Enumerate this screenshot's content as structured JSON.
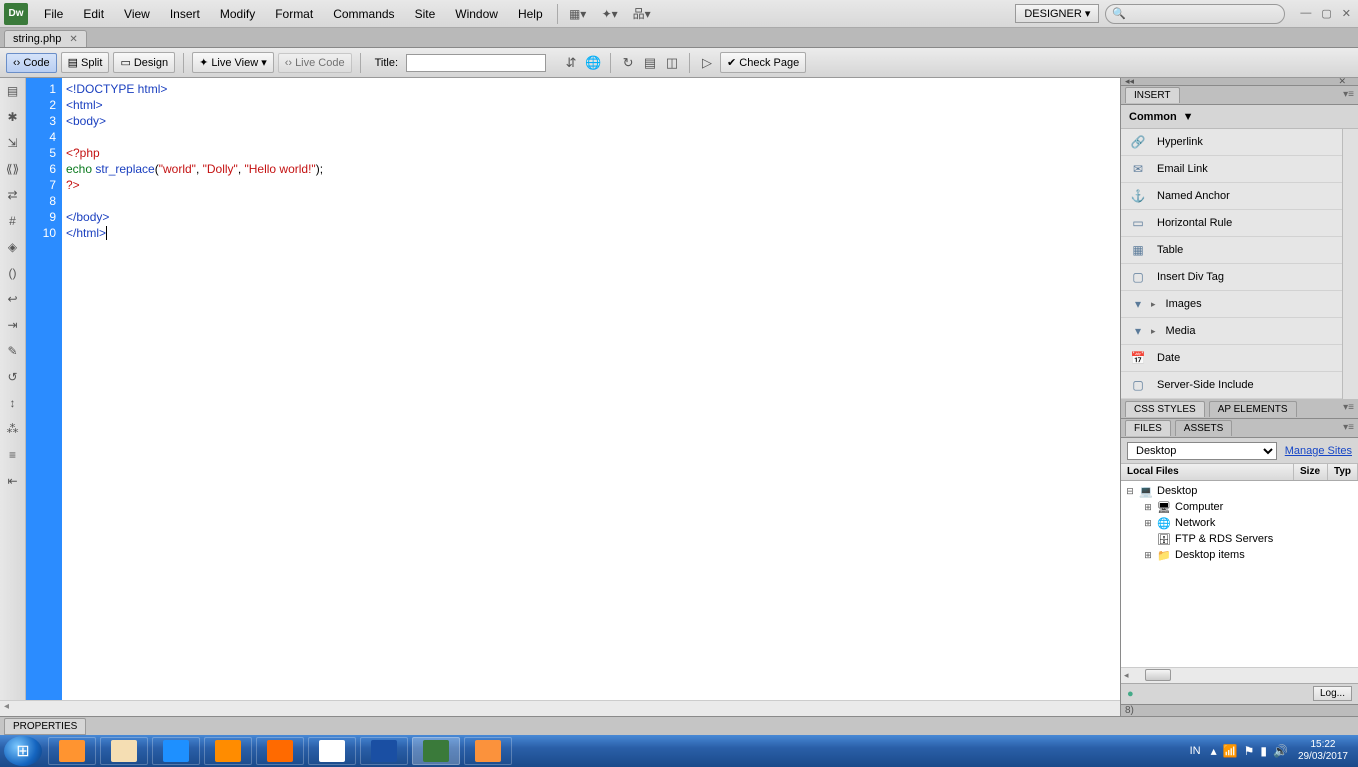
{
  "menubar": {
    "items": [
      "File",
      "Edit",
      "View",
      "Insert",
      "Modify",
      "Format",
      "Commands",
      "Site",
      "Window",
      "Help"
    ],
    "workspace_label": "DESIGNER ▾"
  },
  "tab": {
    "filename": "string.php"
  },
  "toolbar": {
    "code": "Code",
    "split": "Split",
    "design": "Design",
    "live_view": "Live View",
    "live_code": "Live Code",
    "title_label": "Title:",
    "title_value": "",
    "check_page": "Check Page"
  },
  "code": {
    "lines": [
      {
        "n": 1,
        "segs": [
          {
            "t": "<!DOCTYPE html>",
            "c": "c-blue"
          }
        ]
      },
      {
        "n": 2,
        "segs": [
          {
            "t": "<html>",
            "c": "c-blue"
          }
        ]
      },
      {
        "n": 3,
        "segs": [
          {
            "t": "<body>",
            "c": "c-blue"
          }
        ]
      },
      {
        "n": 4,
        "segs": []
      },
      {
        "n": 5,
        "segs": [
          {
            "t": "<?php",
            "c": "c-red"
          }
        ]
      },
      {
        "n": 6,
        "segs": [
          {
            "t": "echo ",
            "c": "c-green"
          },
          {
            "t": "str_replace",
            "c": "c-blue"
          },
          {
            "t": "(",
            "c": ""
          },
          {
            "t": "\"world\"",
            "c": "c-red"
          },
          {
            "t": ", ",
            "c": ""
          },
          {
            "t": "\"Dolly\"",
            "c": "c-red"
          },
          {
            "t": ", ",
            "c": ""
          },
          {
            "t": "\"Hello world!\"",
            "c": "c-red"
          },
          {
            "t": ");",
            "c": ""
          }
        ]
      },
      {
        "n": 7,
        "segs": [
          {
            "t": "?>",
            "c": "c-red"
          }
        ]
      },
      {
        "n": 8,
        "segs": []
      },
      {
        "n": 9,
        "segs": [
          {
            "t": "</body>",
            "c": "c-blue"
          }
        ]
      },
      {
        "n": 10,
        "segs": [
          {
            "t": "</html>",
            "c": "c-blue"
          }
        ],
        "cursor": true
      }
    ]
  },
  "insert_panel": {
    "tab": "INSERT",
    "category": "Common",
    "items": [
      {
        "icon": "🔗",
        "label": "Hyperlink"
      },
      {
        "icon": "✉",
        "label": "Email Link"
      },
      {
        "icon": "⚓",
        "label": "Named Anchor"
      },
      {
        "icon": "▭",
        "label": "Horizontal Rule"
      },
      {
        "icon": "▦",
        "label": "Table"
      },
      {
        "icon": "▢",
        "label": "Insert Div Tag"
      },
      {
        "icon": "▾",
        "label": "Images",
        "sub": true
      },
      {
        "icon": "▾",
        "label": "Media",
        "sub": true
      },
      {
        "icon": "📅",
        "label": "Date"
      },
      {
        "icon": "▢",
        "label": "Server-Side Include"
      }
    ]
  },
  "css_panel": {
    "tabs": [
      "CSS STYLES",
      "AP ELEMENTS"
    ]
  },
  "files_panel": {
    "tabs": [
      "FILES",
      "ASSETS"
    ],
    "select_value": "Desktop",
    "manage": "Manage Sites",
    "cols": [
      "Local Files",
      "Size",
      "Typ"
    ],
    "tree": [
      {
        "depth": 0,
        "toggle": "⊟",
        "icon": "💻",
        "label": "Desktop"
      },
      {
        "depth": 1,
        "toggle": "⊞",
        "icon": "🖥",
        "label": "Computer"
      },
      {
        "depth": 1,
        "toggle": "⊞",
        "icon": "🌐",
        "label": "Network"
      },
      {
        "depth": 1,
        "toggle": "",
        "icon": "🗄",
        "label": "FTP & RDS Servers"
      },
      {
        "depth": 1,
        "toggle": "⊞",
        "icon": "📁",
        "label": "Desktop items"
      }
    ],
    "log_btn": "Log..."
  },
  "properties": {
    "label": "PROPERTIES"
  },
  "taskbar": {
    "apps": [
      {
        "name": "media-player",
        "color": "#ff9430"
      },
      {
        "name": "explorer",
        "color": "#f5deb3"
      },
      {
        "name": "ie",
        "color": "#1e90ff"
      },
      {
        "name": "kupu",
        "color": "#ff8c00"
      },
      {
        "name": "firefox",
        "color": "#ff6a00"
      },
      {
        "name": "chrome",
        "color": "#ffffff"
      },
      {
        "name": "malwarebytes",
        "color": "#1a4fa3"
      },
      {
        "name": "dreamweaver",
        "color": "#3a7a3a",
        "active": true
      },
      {
        "name": "xampp",
        "color": "#fb923c"
      }
    ],
    "tray": {
      "lang": "IN",
      "time": "15:22",
      "date": "29/03/2017"
    }
  }
}
